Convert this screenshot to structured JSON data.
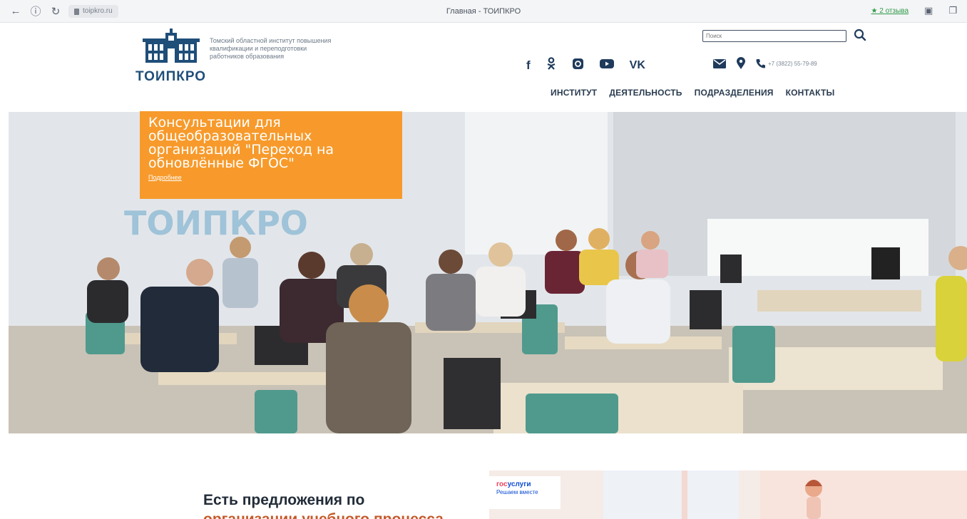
{
  "browser": {
    "url": "toipkro.ru",
    "tab_title": "Главная - ТОИПКРО",
    "reviews_link": "★ 2 отзыва"
  },
  "header": {
    "logo_text": "ТОИПКРО",
    "logo_caption": "Томский областной институт повышения квалификации и переподготовки работников образования",
    "search_placeholder": "Поиск",
    "phone": "+7 (3822) 55-79-89",
    "social_icons": [
      "facebook-icon",
      "odnoklassniki-icon",
      "instagram-icon",
      "youtube-icon",
      "vk-icon"
    ],
    "contact_icons": [
      "mail-icon",
      "location-icon",
      "phone-icon"
    ]
  },
  "nav": {
    "items": [
      {
        "label": "ИНСТИТУТ"
      },
      {
        "label": "ДЕЯТЕЛЬНОСТЬ"
      },
      {
        "label": "ПОДРАЗДЕЛЕНИЯ"
      },
      {
        "label": "КОНТАКТЫ"
      }
    ]
  },
  "hero": {
    "promo_title": "Консультации для общеобразовательных организаций \"Переход на обновлённые ФГОС\"",
    "promo_link": "Подробнее",
    "wall_sign": "ТОИПКРО",
    "promo_color": "#f79a2b"
  },
  "below": {
    "heading_line1": "Есть предложения по",
    "heading_line2": "организации учебного процесса",
    "gos_logo_a": "гос",
    "gos_logo_b": "услуги",
    "gos_slogan": "Решаем вместе"
  },
  "colors": {
    "brand_blue": "#1f4e79",
    "accent_orange": "#f79a2b",
    "gos_blue": "#0d4cd3",
    "gos_red": "#ee3f58"
  }
}
